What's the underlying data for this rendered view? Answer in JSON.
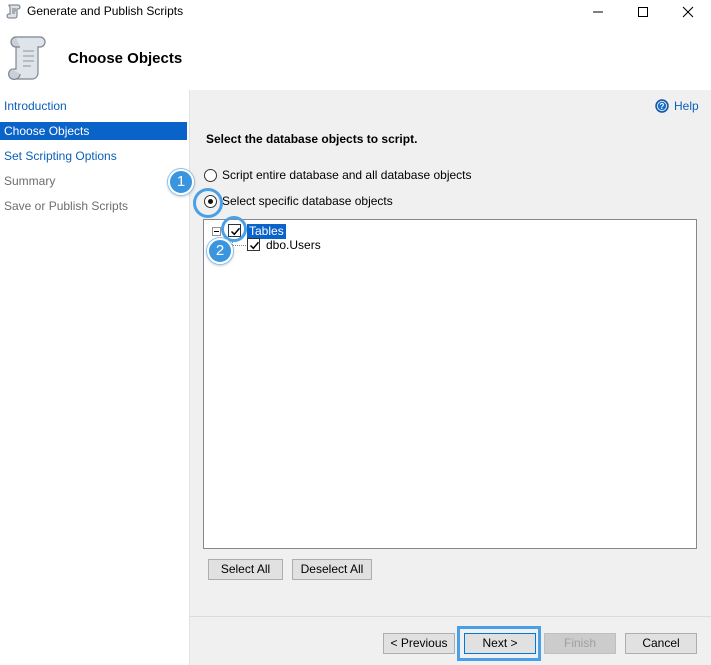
{
  "window": {
    "title": "Generate and Publish Scripts",
    "controls": {
      "minimize": "minimize",
      "maximize": "maximize",
      "close": "close"
    }
  },
  "header": {
    "heading": "Choose Objects"
  },
  "nav": {
    "items": [
      {
        "label": "Introduction",
        "state": "link"
      },
      {
        "label": "Choose Objects",
        "state": "active"
      },
      {
        "label": "Set Scripting Options",
        "state": "link"
      },
      {
        "label": "Summary",
        "state": "disabled"
      },
      {
        "label": "Save or Publish Scripts",
        "state": "disabled"
      }
    ]
  },
  "main": {
    "help_label": "Help",
    "instruction": "Select the database objects to script.",
    "options": [
      {
        "label": "Script entire database and all database objects",
        "selected": false
      },
      {
        "label": "Select specific database objects",
        "selected": true
      }
    ],
    "tree": {
      "root": {
        "label": "Tables",
        "checked": true,
        "expanded": true
      },
      "children": [
        {
          "label": "dbo.Users",
          "checked": true
        }
      ]
    },
    "select_all_label": "Select All",
    "deselect_all_label": "Deselect All"
  },
  "footer": {
    "previous_label": "< Previous",
    "next_label": "Next >",
    "finish_label": "Finish",
    "cancel_label": "Cancel"
  },
  "callouts": [
    "1",
    "2"
  ],
  "colors": {
    "accent": "#0a63c9",
    "link": "#0b5fb8",
    "callout": "#3a95e0",
    "panel": "#f0f0f0"
  }
}
